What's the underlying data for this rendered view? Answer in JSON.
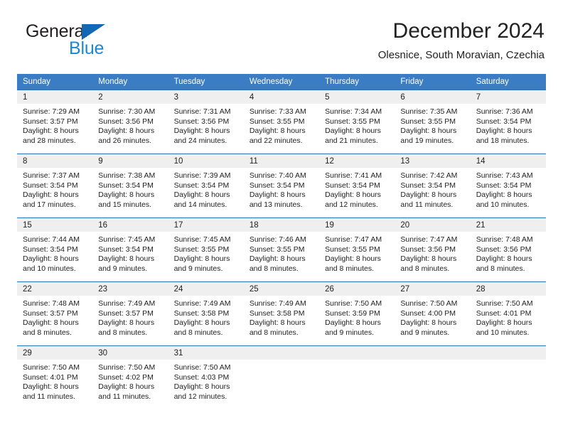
{
  "brand": {
    "name_part1": "General",
    "name_part2": "Blue",
    "triangle_color": "#1268b3",
    "blue_color": "#1e87d6"
  },
  "header": {
    "title": "December 2024",
    "subtitle": "Olesnice, South Moravian, Czechia"
  },
  "theme": {
    "header_bg": "#3b7dc4",
    "row_divider": "#2d6fb5",
    "daynum_bg": "#efefef"
  },
  "weekday_headers": [
    "Sunday",
    "Monday",
    "Tuesday",
    "Wednesday",
    "Thursday",
    "Friday",
    "Saturday"
  ],
  "weeks": [
    [
      {
        "day": "1",
        "sunrise": "Sunrise: 7:29 AM",
        "sunset": "Sunset: 3:57 PM",
        "daylight1": "Daylight: 8 hours",
        "daylight2": "and 28 minutes."
      },
      {
        "day": "2",
        "sunrise": "Sunrise: 7:30 AM",
        "sunset": "Sunset: 3:56 PM",
        "daylight1": "Daylight: 8 hours",
        "daylight2": "and 26 minutes."
      },
      {
        "day": "3",
        "sunrise": "Sunrise: 7:31 AM",
        "sunset": "Sunset: 3:56 PM",
        "daylight1": "Daylight: 8 hours",
        "daylight2": "and 24 minutes."
      },
      {
        "day": "4",
        "sunrise": "Sunrise: 7:33 AM",
        "sunset": "Sunset: 3:55 PM",
        "daylight1": "Daylight: 8 hours",
        "daylight2": "and 22 minutes."
      },
      {
        "day": "5",
        "sunrise": "Sunrise: 7:34 AM",
        "sunset": "Sunset: 3:55 PM",
        "daylight1": "Daylight: 8 hours",
        "daylight2": "and 21 minutes."
      },
      {
        "day": "6",
        "sunrise": "Sunrise: 7:35 AM",
        "sunset": "Sunset: 3:55 PM",
        "daylight1": "Daylight: 8 hours",
        "daylight2": "and 19 minutes."
      },
      {
        "day": "7",
        "sunrise": "Sunrise: 7:36 AM",
        "sunset": "Sunset: 3:54 PM",
        "daylight1": "Daylight: 8 hours",
        "daylight2": "and 18 minutes."
      }
    ],
    [
      {
        "day": "8",
        "sunrise": "Sunrise: 7:37 AM",
        "sunset": "Sunset: 3:54 PM",
        "daylight1": "Daylight: 8 hours",
        "daylight2": "and 17 minutes."
      },
      {
        "day": "9",
        "sunrise": "Sunrise: 7:38 AM",
        "sunset": "Sunset: 3:54 PM",
        "daylight1": "Daylight: 8 hours",
        "daylight2": "and 15 minutes."
      },
      {
        "day": "10",
        "sunrise": "Sunrise: 7:39 AM",
        "sunset": "Sunset: 3:54 PM",
        "daylight1": "Daylight: 8 hours",
        "daylight2": "and 14 minutes."
      },
      {
        "day": "11",
        "sunrise": "Sunrise: 7:40 AM",
        "sunset": "Sunset: 3:54 PM",
        "daylight1": "Daylight: 8 hours",
        "daylight2": "and 13 minutes."
      },
      {
        "day": "12",
        "sunrise": "Sunrise: 7:41 AM",
        "sunset": "Sunset: 3:54 PM",
        "daylight1": "Daylight: 8 hours",
        "daylight2": "and 12 minutes."
      },
      {
        "day": "13",
        "sunrise": "Sunrise: 7:42 AM",
        "sunset": "Sunset: 3:54 PM",
        "daylight1": "Daylight: 8 hours",
        "daylight2": "and 11 minutes."
      },
      {
        "day": "14",
        "sunrise": "Sunrise: 7:43 AM",
        "sunset": "Sunset: 3:54 PM",
        "daylight1": "Daylight: 8 hours",
        "daylight2": "and 10 minutes."
      }
    ],
    [
      {
        "day": "15",
        "sunrise": "Sunrise: 7:44 AM",
        "sunset": "Sunset: 3:54 PM",
        "daylight1": "Daylight: 8 hours",
        "daylight2": "and 10 minutes."
      },
      {
        "day": "16",
        "sunrise": "Sunrise: 7:45 AM",
        "sunset": "Sunset: 3:54 PM",
        "daylight1": "Daylight: 8 hours",
        "daylight2": "and 9 minutes."
      },
      {
        "day": "17",
        "sunrise": "Sunrise: 7:45 AM",
        "sunset": "Sunset: 3:55 PM",
        "daylight1": "Daylight: 8 hours",
        "daylight2": "and 9 minutes."
      },
      {
        "day": "18",
        "sunrise": "Sunrise: 7:46 AM",
        "sunset": "Sunset: 3:55 PM",
        "daylight1": "Daylight: 8 hours",
        "daylight2": "and 8 minutes."
      },
      {
        "day": "19",
        "sunrise": "Sunrise: 7:47 AM",
        "sunset": "Sunset: 3:55 PM",
        "daylight1": "Daylight: 8 hours",
        "daylight2": "and 8 minutes."
      },
      {
        "day": "20",
        "sunrise": "Sunrise: 7:47 AM",
        "sunset": "Sunset: 3:56 PM",
        "daylight1": "Daylight: 8 hours",
        "daylight2": "and 8 minutes."
      },
      {
        "day": "21",
        "sunrise": "Sunrise: 7:48 AM",
        "sunset": "Sunset: 3:56 PM",
        "daylight1": "Daylight: 8 hours",
        "daylight2": "and 8 minutes."
      }
    ],
    [
      {
        "day": "22",
        "sunrise": "Sunrise: 7:48 AM",
        "sunset": "Sunset: 3:57 PM",
        "daylight1": "Daylight: 8 hours",
        "daylight2": "and 8 minutes."
      },
      {
        "day": "23",
        "sunrise": "Sunrise: 7:49 AM",
        "sunset": "Sunset: 3:57 PM",
        "daylight1": "Daylight: 8 hours",
        "daylight2": "and 8 minutes."
      },
      {
        "day": "24",
        "sunrise": "Sunrise: 7:49 AM",
        "sunset": "Sunset: 3:58 PM",
        "daylight1": "Daylight: 8 hours",
        "daylight2": "and 8 minutes."
      },
      {
        "day": "25",
        "sunrise": "Sunrise: 7:49 AM",
        "sunset": "Sunset: 3:58 PM",
        "daylight1": "Daylight: 8 hours",
        "daylight2": "and 8 minutes."
      },
      {
        "day": "26",
        "sunrise": "Sunrise: 7:50 AM",
        "sunset": "Sunset: 3:59 PM",
        "daylight1": "Daylight: 8 hours",
        "daylight2": "and 9 minutes."
      },
      {
        "day": "27",
        "sunrise": "Sunrise: 7:50 AM",
        "sunset": "Sunset: 4:00 PM",
        "daylight1": "Daylight: 8 hours",
        "daylight2": "and 9 minutes."
      },
      {
        "day": "28",
        "sunrise": "Sunrise: 7:50 AM",
        "sunset": "Sunset: 4:01 PM",
        "daylight1": "Daylight: 8 hours",
        "daylight2": "and 10 minutes."
      }
    ],
    [
      {
        "day": "29",
        "sunrise": "Sunrise: 7:50 AM",
        "sunset": "Sunset: 4:01 PM",
        "daylight1": "Daylight: 8 hours",
        "daylight2": "and 11 minutes."
      },
      {
        "day": "30",
        "sunrise": "Sunrise: 7:50 AM",
        "sunset": "Sunset: 4:02 PM",
        "daylight1": "Daylight: 8 hours",
        "daylight2": "and 11 minutes."
      },
      {
        "day": "31",
        "sunrise": "Sunrise: 7:50 AM",
        "sunset": "Sunset: 4:03 PM",
        "daylight1": "Daylight: 8 hours",
        "daylight2": "and 12 minutes."
      },
      {
        "day": "",
        "sunrise": "",
        "sunset": "",
        "daylight1": "",
        "daylight2": ""
      },
      {
        "day": "",
        "sunrise": "",
        "sunset": "",
        "daylight1": "",
        "daylight2": ""
      },
      {
        "day": "",
        "sunrise": "",
        "sunset": "",
        "daylight1": "",
        "daylight2": ""
      },
      {
        "day": "",
        "sunrise": "",
        "sunset": "",
        "daylight1": "",
        "daylight2": ""
      }
    ]
  ]
}
